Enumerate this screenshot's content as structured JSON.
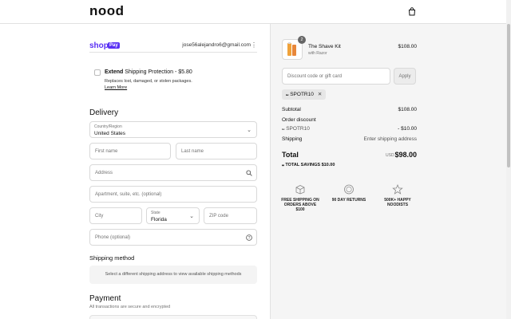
{
  "header": {
    "logo": "nood",
    "cart_icon": "shopping-bag-icon"
  },
  "express": {
    "shop_label": "shop",
    "pay_label": "Pay",
    "email": "jose56alejandro6@gmail.com",
    "menu_icon": "kebab-menu-icon"
  },
  "extend": {
    "brand": "Extend",
    "title": "Shipping Protection",
    "price": "- $5.80",
    "description": "Replaces lost, damaged, or stolen packages.",
    "link": "Learn More",
    "checked": false
  },
  "delivery": {
    "heading": "Delivery",
    "country_label": "Country/Region",
    "country_value": "United States",
    "first_name_placeholder": "First name",
    "last_name_placeholder": "Last name",
    "address_placeholder": "Address",
    "apartment_placeholder": "Apartment, suite, etc. (optional)",
    "city_placeholder": "City",
    "state_label": "State",
    "state_value": "Florida",
    "zip_placeholder": "ZIP code",
    "phone_placeholder": "Phone (optional)"
  },
  "shipping_method": {
    "heading": "Shipping method",
    "message": "Select a different shipping address to view available shipping methods"
  },
  "payment": {
    "heading": "Payment",
    "subtext": "All transactions are secure and encrypted"
  },
  "order": {
    "item": {
      "name": "The Shave Kit",
      "variant": "with Razor",
      "price": "$108.00",
      "quantity": "2"
    },
    "discount_placeholder": "Discount code or gift card",
    "apply_label": "Apply",
    "applied_code": "SPOTR10",
    "subtotal_label": "Subtotal",
    "subtotal_value": "$108.00",
    "order_discount_label": "Order discount",
    "discount_code": "SPOTR10",
    "discount_value": "- $10.00",
    "shipping_label": "Shipping",
    "shipping_value": "Enter shipping address",
    "total_label": "Total",
    "total_currency": "USD",
    "total_value": "$98.00",
    "savings_label": "TOTAL SAVINGS",
    "savings_value": "$10.00"
  },
  "perks": [
    {
      "icon": "box-icon",
      "label": "FREE SHIPPING ON ORDERS ABOVE $100"
    },
    {
      "icon": "badge-icon",
      "label": "90 DAY RETURNS"
    },
    {
      "icon": "star-icon",
      "label": "500K+ HAPPY NOODISTS"
    }
  ],
  "colors": {
    "shop_pay": "#5a31f4",
    "summary_bg": "#f5f5f5"
  }
}
